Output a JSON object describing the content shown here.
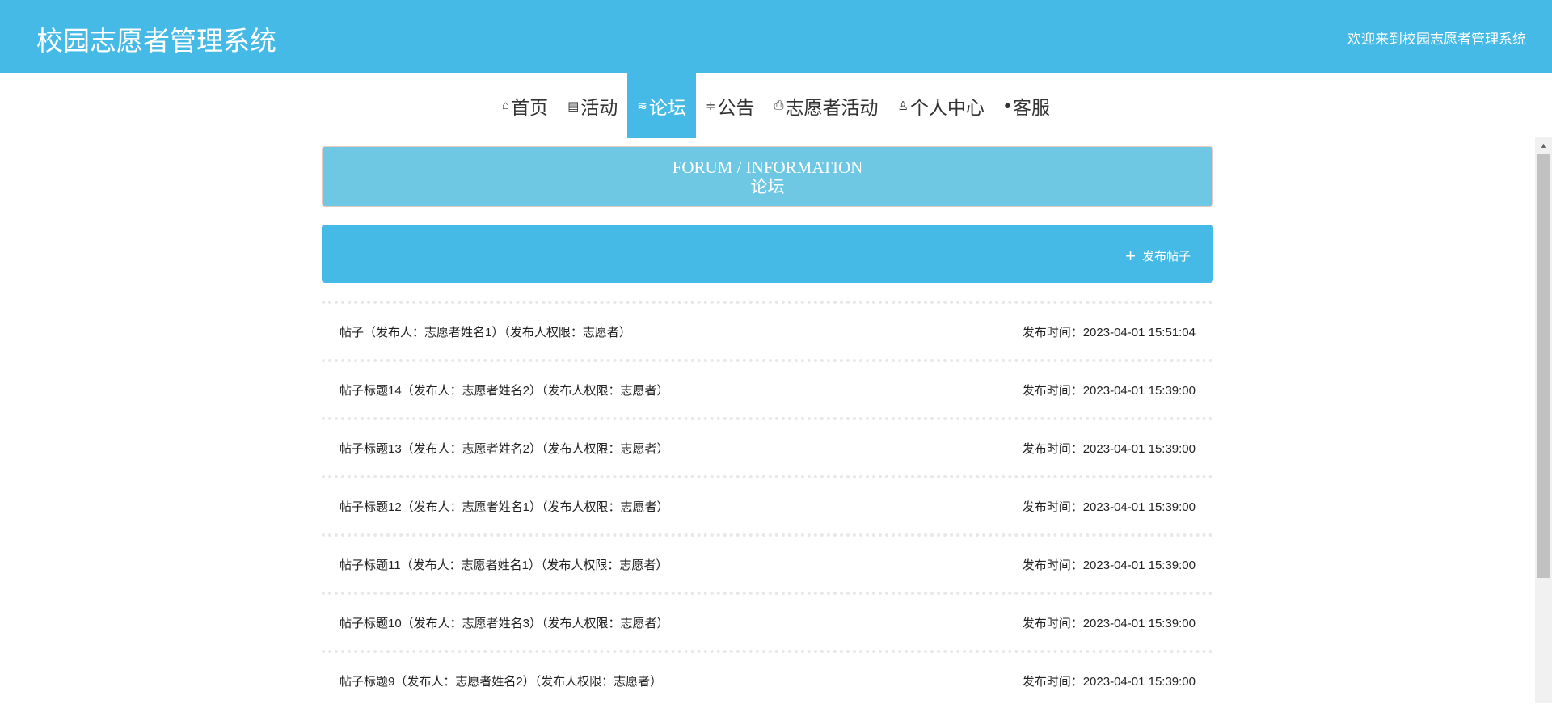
{
  "header": {
    "title": "校园志愿者管理系统",
    "welcome": "欢迎来到校园志愿者管理系统"
  },
  "nav": [
    {
      "label": "首页",
      "icon": "home-icon",
      "glyph": "⌂"
    },
    {
      "label": "活动",
      "icon": "notepad-icon",
      "glyph": "▤"
    },
    {
      "label": "论坛",
      "icon": "layers-icon",
      "glyph": "≋"
    },
    {
      "label": "公告",
      "icon": "sliders-icon",
      "glyph": "≑"
    },
    {
      "label": "志愿者活动",
      "icon": "printer-icon",
      "glyph": "⎙"
    },
    {
      "label": "个人中心",
      "icon": "user-icon",
      "glyph": "♙"
    },
    {
      "label": "客服",
      "icon": "chat-icon",
      "glyph": "●"
    }
  ],
  "banner": {
    "en": "FORUM / INFORMATION",
    "cn": "论坛"
  },
  "add_button": "发布帖子",
  "posts": [
    {
      "title": "帖子（发布人：志愿者姓名1）（发布人权限：志愿者）",
      "time": "发布时间：2023-04-01 15:51:04"
    },
    {
      "title": "帖子标题14（发布人：志愿者姓名2）（发布人权限：志愿者）",
      "time": "发布时间：2023-04-01 15:39:00"
    },
    {
      "title": "帖子标题13（发布人：志愿者姓名2）（发布人权限：志愿者）",
      "time": "发布时间：2023-04-01 15:39:00"
    },
    {
      "title": "帖子标题12（发布人：志愿者姓名1）（发布人权限：志愿者）",
      "time": "发布时间：2023-04-01 15:39:00"
    },
    {
      "title": "帖子标题11（发布人：志愿者姓名1）（发布人权限：志愿者）",
      "time": "发布时间：2023-04-01 15:39:00"
    },
    {
      "title": "帖子标题10（发布人：志愿者姓名3）（发布人权限：志愿者）",
      "time": "发布时间：2023-04-01 15:39:00"
    },
    {
      "title": "帖子标题9（发布人：志愿者姓名2）（发布人权限：志愿者）",
      "time": "发布时间：2023-04-01 15:39:00"
    }
  ]
}
